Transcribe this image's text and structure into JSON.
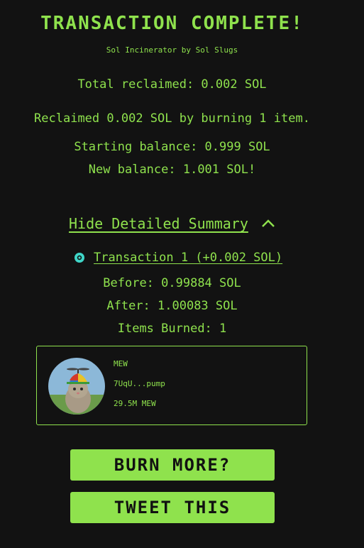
{
  "header": {
    "title": "TRANSACTION COMPLETE!",
    "subtitle": "Sol Incinerator by Sol Slugs"
  },
  "summary": {
    "total_reclaimed": "Total reclaimed: 0.002 SOL",
    "reclaimed_detail": "Reclaimed 0.002 SOL by burning 1 item.",
    "starting_balance": "Starting balance: 0.999 SOL",
    "new_balance": "New balance: 1.001 SOL!"
  },
  "details_toggle": {
    "label": "Hide Detailed Summary",
    "icon": "chevron-up-icon"
  },
  "transaction": {
    "link_label": "Transaction 1 (+0.002 SOL)",
    "before": "Before: 0.99884 SOL",
    "after": "After: 1.00083 SOL",
    "items_burned": "Items Burned: 1"
  },
  "burned_item": {
    "name": "MEW",
    "address": "7UqU...pump",
    "amount": "29.5M MEW"
  },
  "actions": {
    "burn_more": "BURN MORE?",
    "tweet": "TWEET THIS"
  },
  "colors": {
    "accent": "#8fe24d",
    "background": "#121212",
    "button_text": "#111111"
  }
}
